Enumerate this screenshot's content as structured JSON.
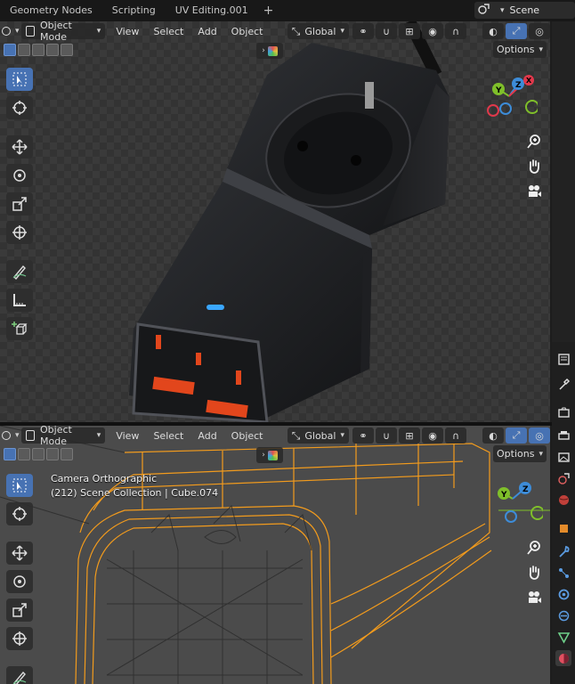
{
  "workspace_tabs": [
    "Geometry Nodes",
    "Scripting",
    "UV Editing.001"
  ],
  "add_tab": "+",
  "scene": {
    "label": "Scene"
  },
  "viewport_top": {
    "mode": "Object Mode",
    "menus": [
      "View",
      "Select",
      "Add",
      "Object"
    ],
    "transform_orientation": "Global",
    "options_label": "Options"
  },
  "viewport_bottom": {
    "mode": "Object Mode",
    "menus": [
      "View",
      "Select",
      "Add",
      "Object"
    ],
    "transform_orientation": "Global",
    "options_label": "Options",
    "camera_label": "Camera Orthographic",
    "collection_info": "(212) Scene Collection | Cube.074"
  },
  "gizmo_axes": [
    "X",
    "Y",
    "Z"
  ],
  "colors": {
    "accent": "#4772b3",
    "x_axis": "#e0384b",
    "y_axis": "#7fbf2a",
    "z_axis": "#3d8cd8",
    "wire_selected": "#f29b1d",
    "led": "#3aa7ff",
    "socket_red": "#e2461c"
  }
}
